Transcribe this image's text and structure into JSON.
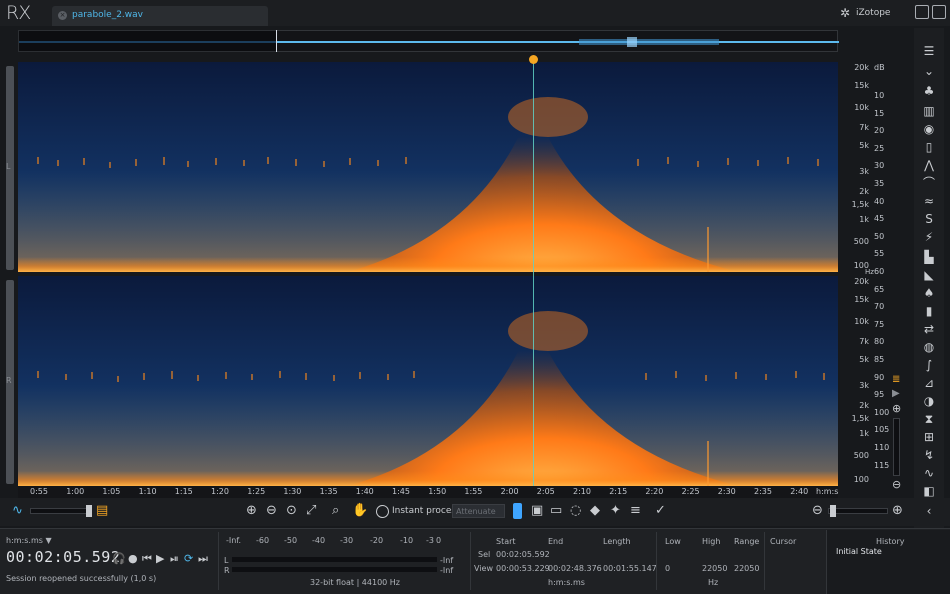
{
  "app": {
    "logo": "RX",
    "brand": "iZotope"
  },
  "tab": {
    "filename": "parabole_2.wav",
    "close": "×"
  },
  "channels": {
    "left": "L",
    "right": "R"
  },
  "hz_scale": {
    "unit": "Hz",
    "labels": [
      "20k",
      "15k",
      "10k",
      "7k",
      "5k",
      "3k",
      "2k",
      "1,5k",
      "1k",
      "500",
      "100"
    ]
  },
  "db_scale": {
    "unit": "dB",
    "labels": [
      "10",
      "15",
      "20",
      "25",
      "30",
      "35",
      "40",
      "45",
      "50",
      "55",
      "60",
      "65",
      "70",
      "75",
      "80",
      "85",
      "90",
      "95",
      "100",
      "105",
      "110",
      "115"
    ]
  },
  "time_ruler": {
    "labels": [
      "0:55",
      "1:00",
      "1:05",
      "1:10",
      "1:15",
      "1:20",
      "1:25",
      "1:30",
      "1:35",
      "1:40",
      "1:45",
      "1:50",
      "1:55",
      "2:00",
      "2:05",
      "2:10",
      "2:15",
      "2:20",
      "2:25",
      "2:30",
      "2:35",
      "2:40",
      "h:m:s"
    ]
  },
  "toolbar": {
    "instant_process": "Instant process",
    "attenuate": "Attenuate"
  },
  "transport": {
    "time_format": "h:m:s.ms",
    "time_format_arrow": "▼",
    "current_time": "00:02:05.592",
    "status": "Session reopened successfully (1,0 s)"
  },
  "meter": {
    "scale": [
      "-Inf.",
      "-60",
      "-50",
      "-40",
      "-30",
      "-20",
      "-10",
      "-3",
      "0"
    ],
    "left_label": "L",
    "right_label": "R",
    "left_peak": "-Inf",
    "right_peak": "-Inf",
    "format": "32-bit float | 44100 Hz"
  },
  "selection": {
    "headers": {
      "start": "Start",
      "end": "End",
      "length": "Length",
      "low": "Low",
      "high": "High",
      "range": "Range",
      "cursor": "Cursor"
    },
    "sel_label": "Sel",
    "view_label": "View",
    "sel_start": "00:02:05.592",
    "view_start": "00:00:53.229",
    "view_end": "00:02:48.376",
    "view_length": "00:01:55.147",
    "view_low": "0",
    "view_high": "22050",
    "view_range": "22050",
    "time_unit": "h:m:s.ms",
    "freq_unit": "Hz"
  },
  "history": {
    "title": "History",
    "item": "Initial State"
  },
  "colors": {
    "accent": "#4fb6e8",
    "playhead": "#f5a623",
    "spectrum_hot": "#ff8a1a",
    "spectrum_cold": "#0d2a5c"
  }
}
